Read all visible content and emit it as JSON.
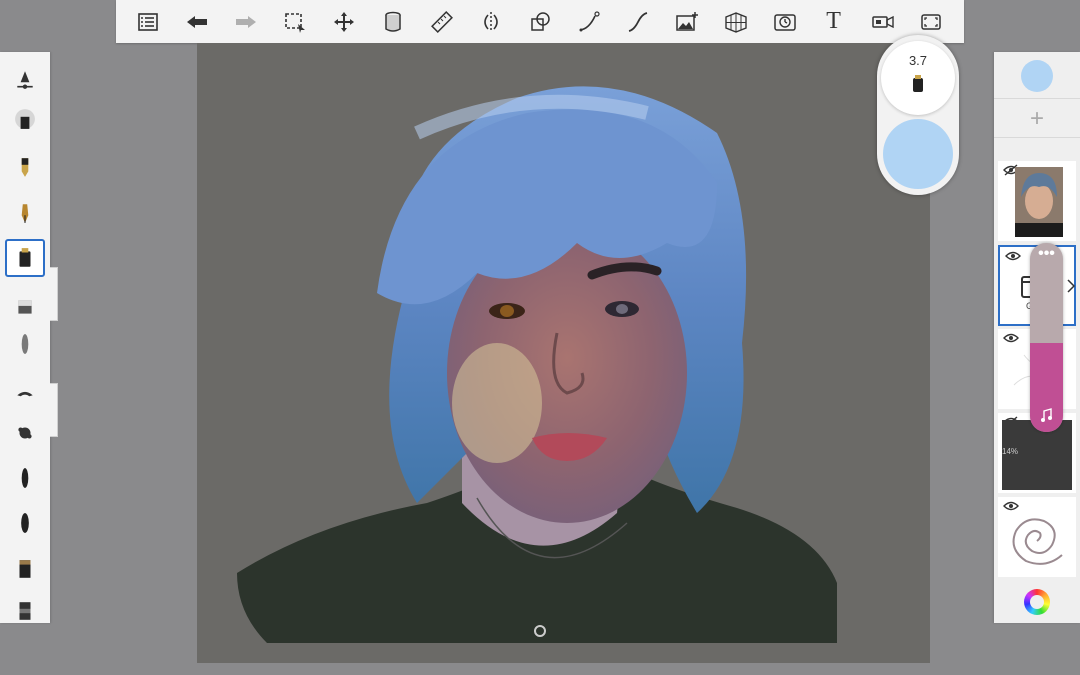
{
  "toolbar": {
    "items": [
      {
        "name": "gallery-list-icon"
      },
      {
        "name": "undo-icon"
      },
      {
        "name": "redo-icon",
        "disabled": true
      },
      {
        "name": "selection-icon"
      },
      {
        "name": "transform-icon"
      },
      {
        "name": "fill-bucket-icon"
      },
      {
        "name": "ruler-icon"
      },
      {
        "name": "symmetry-icon"
      },
      {
        "name": "shapes-icon"
      },
      {
        "name": "stroke-icon"
      },
      {
        "name": "curve-icon"
      },
      {
        "name": "import-image-icon"
      },
      {
        "name": "perspective-grid-icon"
      },
      {
        "name": "time-lapse-icon"
      },
      {
        "name": "text-icon"
      },
      {
        "name": "record-icon"
      },
      {
        "name": "fullscreen-icon"
      }
    ],
    "text_tool_glyph": "T"
  },
  "brush_tray": {
    "selected_index": 4,
    "items": [
      {
        "name": "brush-settings-icon"
      },
      {
        "name": "airbrush-icon"
      },
      {
        "name": "pencil-icon"
      },
      {
        "name": "ink-pen-icon"
      },
      {
        "name": "marker-icon"
      },
      {
        "name": "eraser-icon"
      },
      {
        "name": "soft-brush-icon"
      },
      {
        "name": "smudge-icon"
      },
      {
        "name": "texture-brush-icon"
      },
      {
        "name": "hard-brush-icon"
      },
      {
        "name": "flat-brush-icon"
      },
      {
        "name": "paint-tube-icon"
      },
      {
        "name": "paint-tube-2-icon"
      }
    ]
  },
  "puck": {
    "brush_size": "3.7",
    "current_color": "#b0d4f4"
  },
  "layers": {
    "swatch_color": "#b0d4f4",
    "add_label": "+",
    "items": [
      {
        "name": "photo-reference-layer"
      },
      {
        "name": "group-layer",
        "label": "Gr",
        "selected": true
      },
      {
        "name": "sketch-layer"
      },
      {
        "name": "texture-layer",
        "label": "14%"
      },
      {
        "name": "swirl-layer"
      }
    ],
    "opacity_more": "•••",
    "opacity_fraction": 0.47
  },
  "colors": {
    "accent": "#2d6fc7",
    "canvas_bg": "#6b6a67",
    "hair": "#5f86c4",
    "shirt": "#2c342c",
    "slider_fill": "#c04f94"
  }
}
